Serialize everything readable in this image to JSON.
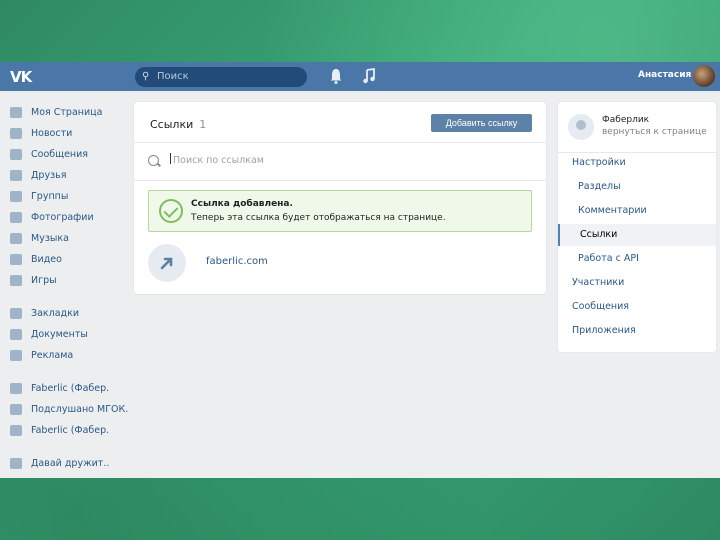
{
  "header": {
    "logo": "VK",
    "search_placeholder": "Поиск",
    "user_name": "Анастасия"
  },
  "left_nav": {
    "group1": [
      {
        "label": "Моя Страница",
        "icon": "home-icon"
      },
      {
        "label": "Новости",
        "icon": "news-icon"
      },
      {
        "label": "Сообщения",
        "icon": "messages-icon"
      },
      {
        "label": "Друзья",
        "icon": "friends-icon"
      },
      {
        "label": "Группы",
        "icon": "groups-icon"
      },
      {
        "label": "Фотографии",
        "icon": "photos-icon"
      },
      {
        "label": "Музыка",
        "icon": "music-icon"
      },
      {
        "label": "Видео",
        "icon": "video-icon"
      },
      {
        "label": "Игры",
        "icon": "games-icon"
      }
    ],
    "group2": [
      {
        "label": "Закладки",
        "icon": "bookmarks-icon"
      },
      {
        "label": "Документы",
        "icon": "documents-icon"
      },
      {
        "label": "Реклама",
        "icon": "ads-icon"
      }
    ],
    "group3": [
      {
        "label": "Faberlic (Фабер.",
        "icon": "community-icon"
      },
      {
        "label": "Подслушано МГОК.",
        "icon": "community-icon"
      },
      {
        "label": "Faberlic (Фабер.",
        "icon": "community-icon"
      }
    ],
    "group4": [
      {
        "label": "Давай дружит..",
        "icon": "apps-icon"
      }
    ]
  },
  "main": {
    "title": "Ссылки",
    "count": "1",
    "add_button": "Добавить ссылку",
    "search_placeholder": "Поиск по ссылкам",
    "success": {
      "title": "Ссылка добавлена.",
      "text": "Теперь эта ссылка будет отображаться на странице."
    },
    "link": {
      "url": "faberlic.com"
    }
  },
  "right": {
    "community_name": "Фаберлик",
    "community_sub": "вернуться к странице",
    "items": [
      {
        "label": "Настройки",
        "level": 0,
        "active": false
      },
      {
        "label": "Разделы",
        "level": 1,
        "active": false
      },
      {
        "label": "Комментарии",
        "level": 1,
        "active": false
      },
      {
        "label": "Ссылки",
        "level": 1,
        "active": true
      },
      {
        "label": "Работа с API",
        "level": 1,
        "active": false
      },
      {
        "label": "Участники",
        "level": 0,
        "active": false
      },
      {
        "label": "Сообщения",
        "level": 0,
        "active": false
      },
      {
        "label": "Приложения",
        "level": 0,
        "active": false
      }
    ]
  },
  "colors": {
    "header": "#4a76a8",
    "accent": "#5181b8",
    "success_border": "#b5d99c"
  }
}
